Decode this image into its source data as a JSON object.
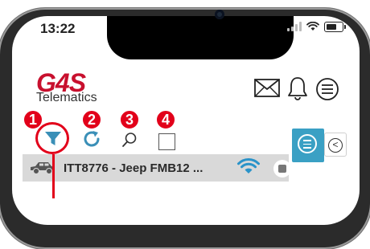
{
  "status_bar": {
    "time": "13:22"
  },
  "header": {
    "logo_text": "G4S",
    "logo_subtext": "Telematics",
    "icons": [
      "envelope-icon",
      "bell-icon",
      "hamburger-menu-icon"
    ]
  },
  "toolbar": {
    "badges": [
      "1",
      "2",
      "3",
      "4"
    ],
    "tools": [
      "filter-icon",
      "refresh-icon",
      "search-icon",
      "select-checkbox"
    ]
  },
  "vehicle": {
    "label": "ITT8776 - Jeep FMB12 ..."
  },
  "side_panel": {
    "collapse_glyph": "<"
  },
  "colors": {
    "accent_red": "#e2001a",
    "brand_red": "#c8102e",
    "toolbar_blue": "#3a8fb7",
    "panel_blue": "#3aa0c4",
    "row_gray": "#d9d9d9"
  }
}
